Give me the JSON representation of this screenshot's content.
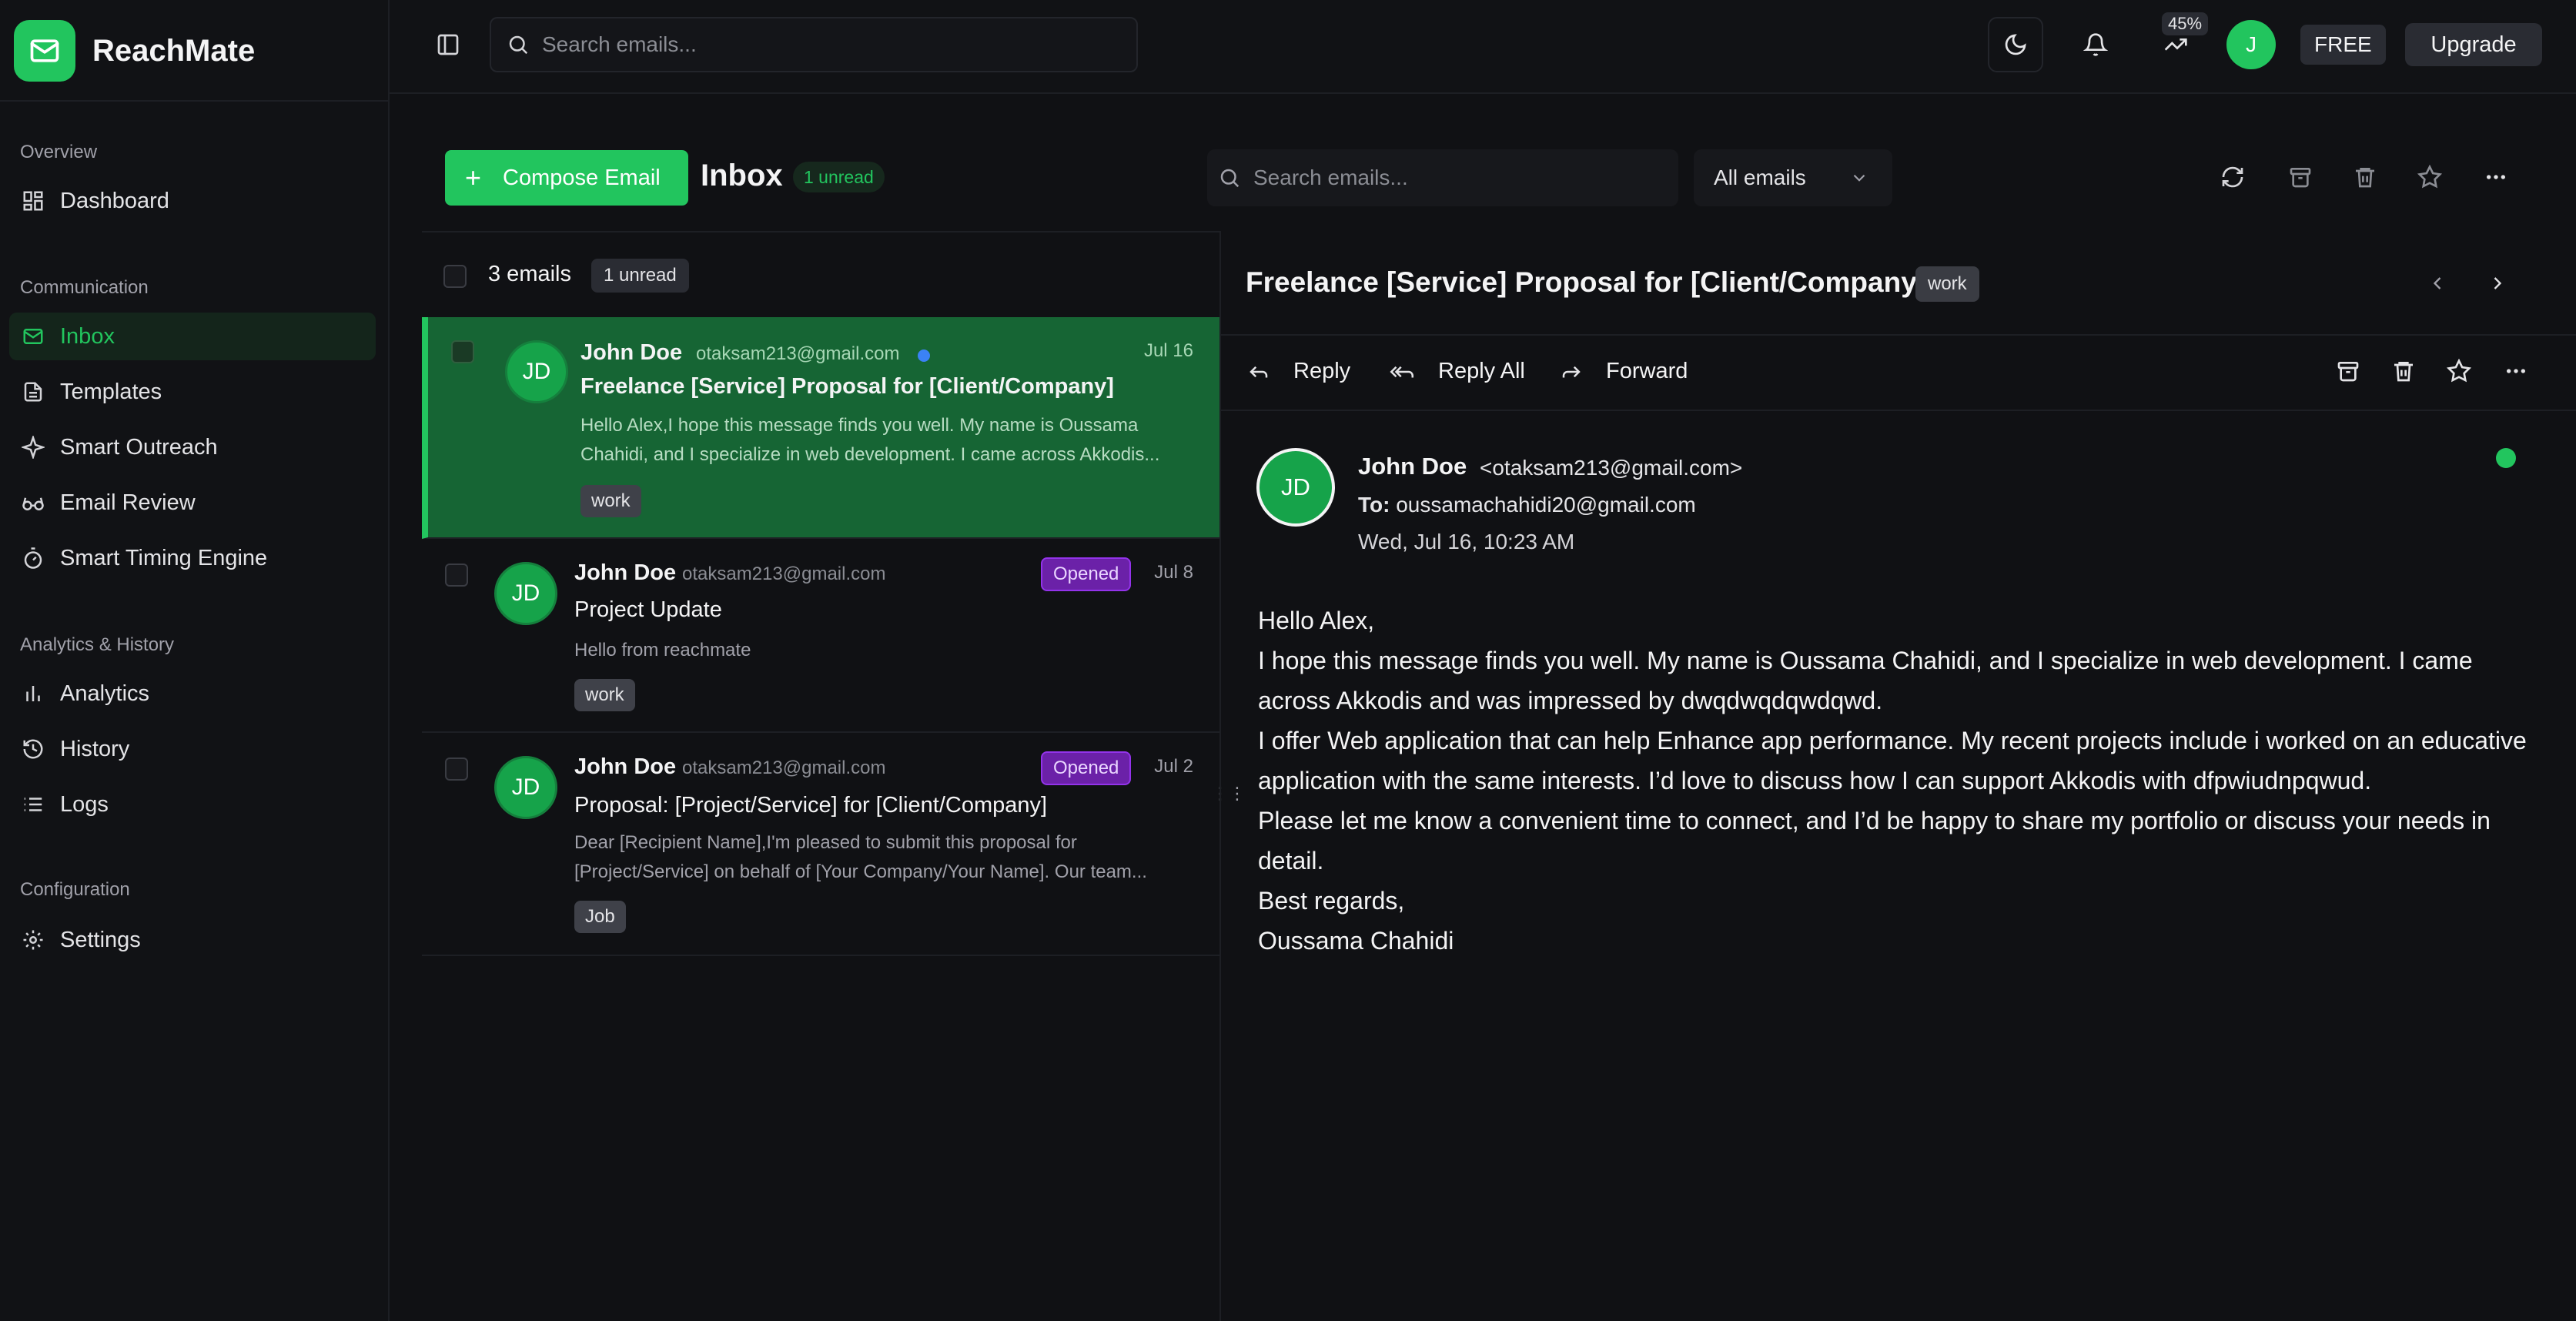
{
  "app": {
    "name": "ReachMate"
  },
  "topbar": {
    "search_placeholder": "Search emails...",
    "usage_percent": "45%",
    "avatar_initial": "J",
    "plan": "FREE",
    "upgrade_label": "Upgrade"
  },
  "sidebar": {
    "sections": [
      {
        "title": "Overview",
        "items": [
          {
            "label": "Dashboard",
            "icon": "dashboard-icon"
          }
        ]
      },
      {
        "title": "Communication",
        "items": [
          {
            "label": "Inbox",
            "icon": "mail-icon",
            "active": true
          },
          {
            "label": "Templates",
            "icon": "document-icon"
          },
          {
            "label": "Smart Outreach",
            "icon": "sparkle-icon"
          },
          {
            "label": "Email Review",
            "icon": "glasses-icon"
          },
          {
            "label": "Smart Timing Engine",
            "icon": "timer-icon"
          }
        ]
      },
      {
        "title": "Analytics & History",
        "items": [
          {
            "label": "Analytics",
            "icon": "bar-chart-icon"
          },
          {
            "label": "History",
            "icon": "history-icon"
          },
          {
            "label": "Logs",
            "icon": "list-icon"
          }
        ]
      },
      {
        "title": "Configuration",
        "items": [
          {
            "label": "Settings",
            "icon": "gear-icon"
          }
        ]
      }
    ]
  },
  "toolbar": {
    "compose_label": "Compose Email",
    "title": "Inbox",
    "unread_badge": "1 unread",
    "search_placeholder": "Search emails...",
    "filter_selected": "All emails"
  },
  "list": {
    "count_label": "3 emails",
    "unread_label": "1 unread",
    "emails": [
      {
        "initials": "JD",
        "name": "John Doe",
        "email": "otaksam213@gmail.com",
        "date": "Jul 16",
        "subject": "Freelance [Service] Proposal for [Client/Company]",
        "snippet": "Hello Alex,I hope this message finds you well. My name is Oussama Chahidi, and I specialize in web development. I came across Akkodis...",
        "tag": "work",
        "status": "",
        "unread": true
      },
      {
        "initials": "JD",
        "name": "John Doe",
        "email": "otaksam213@gmail.com",
        "date": "Jul 8",
        "subject": "Project Update",
        "snippet": "Hello from reachmate",
        "tag": "work",
        "status": "Opened",
        "unread": false
      },
      {
        "initials": "JD",
        "name": "John Doe",
        "email": "otaksam213@gmail.com",
        "date": "Jul 2",
        "subject": "Proposal: [Project/Service] for [Client/Company]",
        "snippet": "Dear [Recipient Name],I'm pleased to submit this proposal for [Project/Service] on behalf of [Your Company/Your Name]. Our team...",
        "tag": "Job",
        "status": "Opened",
        "unread": false
      }
    ]
  },
  "reader": {
    "subject": "Freelance [Service] Proposal for [Client/Company]",
    "tag": "work",
    "actions": {
      "reply": "Reply",
      "reply_all": "Reply All",
      "forward": "Forward"
    },
    "from_initials": "JD",
    "from_name": "John Doe",
    "from_email": "<otaksam213@gmail.com>",
    "to_label": "To:",
    "to_email": "oussamachahidi20@gmail.com",
    "date": "Wed, Jul 16, 10:23 AM",
    "body": [
      "Hello Alex,",
      "I hope this message finds you well. My name is Oussama Chahidi, and I specialize in web development. I came across Akkodis and was impressed by dwqdwqdqwdqwd.",
      "I offer Web application that can help Enhance app performance. My recent projects include i worked on an educative application with the same interests. I’d love to discuss how I can support Akkodis with dfpwiudnpqwud.",
      "Please let me know a convenient time to connect, and I’d be happy to share my portfolio or discuss your needs in detail.",
      "Best regards,",
      "Oussama Chahidi"
    ]
  },
  "colors": {
    "accent": "#22c55e",
    "selected_row": "#166534",
    "opened_badge": "#6b21a8",
    "background": "#101114"
  }
}
